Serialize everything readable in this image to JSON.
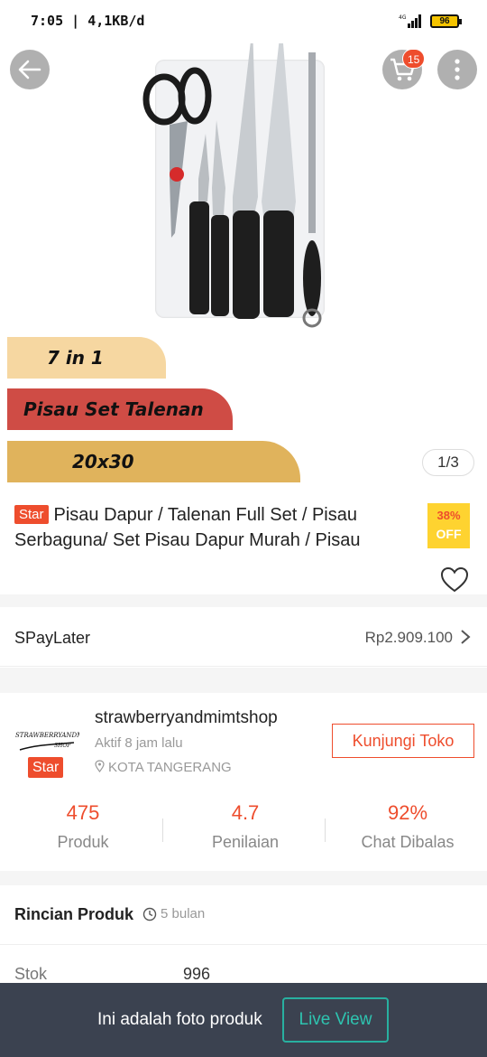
{
  "status_bar": {
    "text": "7:05 | 4,1KB/d",
    "battery": "96"
  },
  "nav": {
    "cart_count": "15"
  },
  "banners": {
    "line1": "7 in 1",
    "line2": "Pisau Set Talenan",
    "line3": "20x30"
  },
  "gallery": {
    "indicator": "1/3"
  },
  "product": {
    "badge": "Star",
    "title": "Pisau Dapur / Talenan Full Set / Pisau Serbaguna/ Set Pisau Dapur Murah / Pisau",
    "discount_percent": "38%",
    "discount_label": "OFF"
  },
  "spaylater": {
    "label": "SPayLater",
    "value": "Rp2.909.100"
  },
  "shop": {
    "logo_text": "STRAWBERRYANDMIMI SHOP",
    "badge": "Star",
    "name": "strawberryandmimtshop",
    "active": "Aktif 8 jam lalu",
    "location": "KOTA TANGERANG",
    "visit_label": "Kunjungi Toko",
    "stats": [
      {
        "value": "475",
        "label": "Produk"
      },
      {
        "value": "4.7",
        "label": "Penilaian"
      },
      {
        "value": "92%",
        "label": "Chat Dibalas"
      }
    ]
  },
  "details": {
    "title": "Rincian Produk",
    "time": "5 bulan",
    "rows": [
      {
        "label": "Stok",
        "value": "996"
      }
    ]
  },
  "bottom_bar": {
    "text": "Ini adalah foto produk",
    "button": "Live View"
  },
  "colors": {
    "accent": "#ee4d2d",
    "teal": "#2ec4b0",
    "bottom_bar": "#3b4250",
    "discount_bg": "#fed330"
  },
  "icons": [
    "back-arrow-icon",
    "cart-icon",
    "more-vertical-icon",
    "heart-icon",
    "chevron-right-icon",
    "location-pin-icon",
    "clock-icon",
    "signal-icon",
    "battery-icon"
  ]
}
